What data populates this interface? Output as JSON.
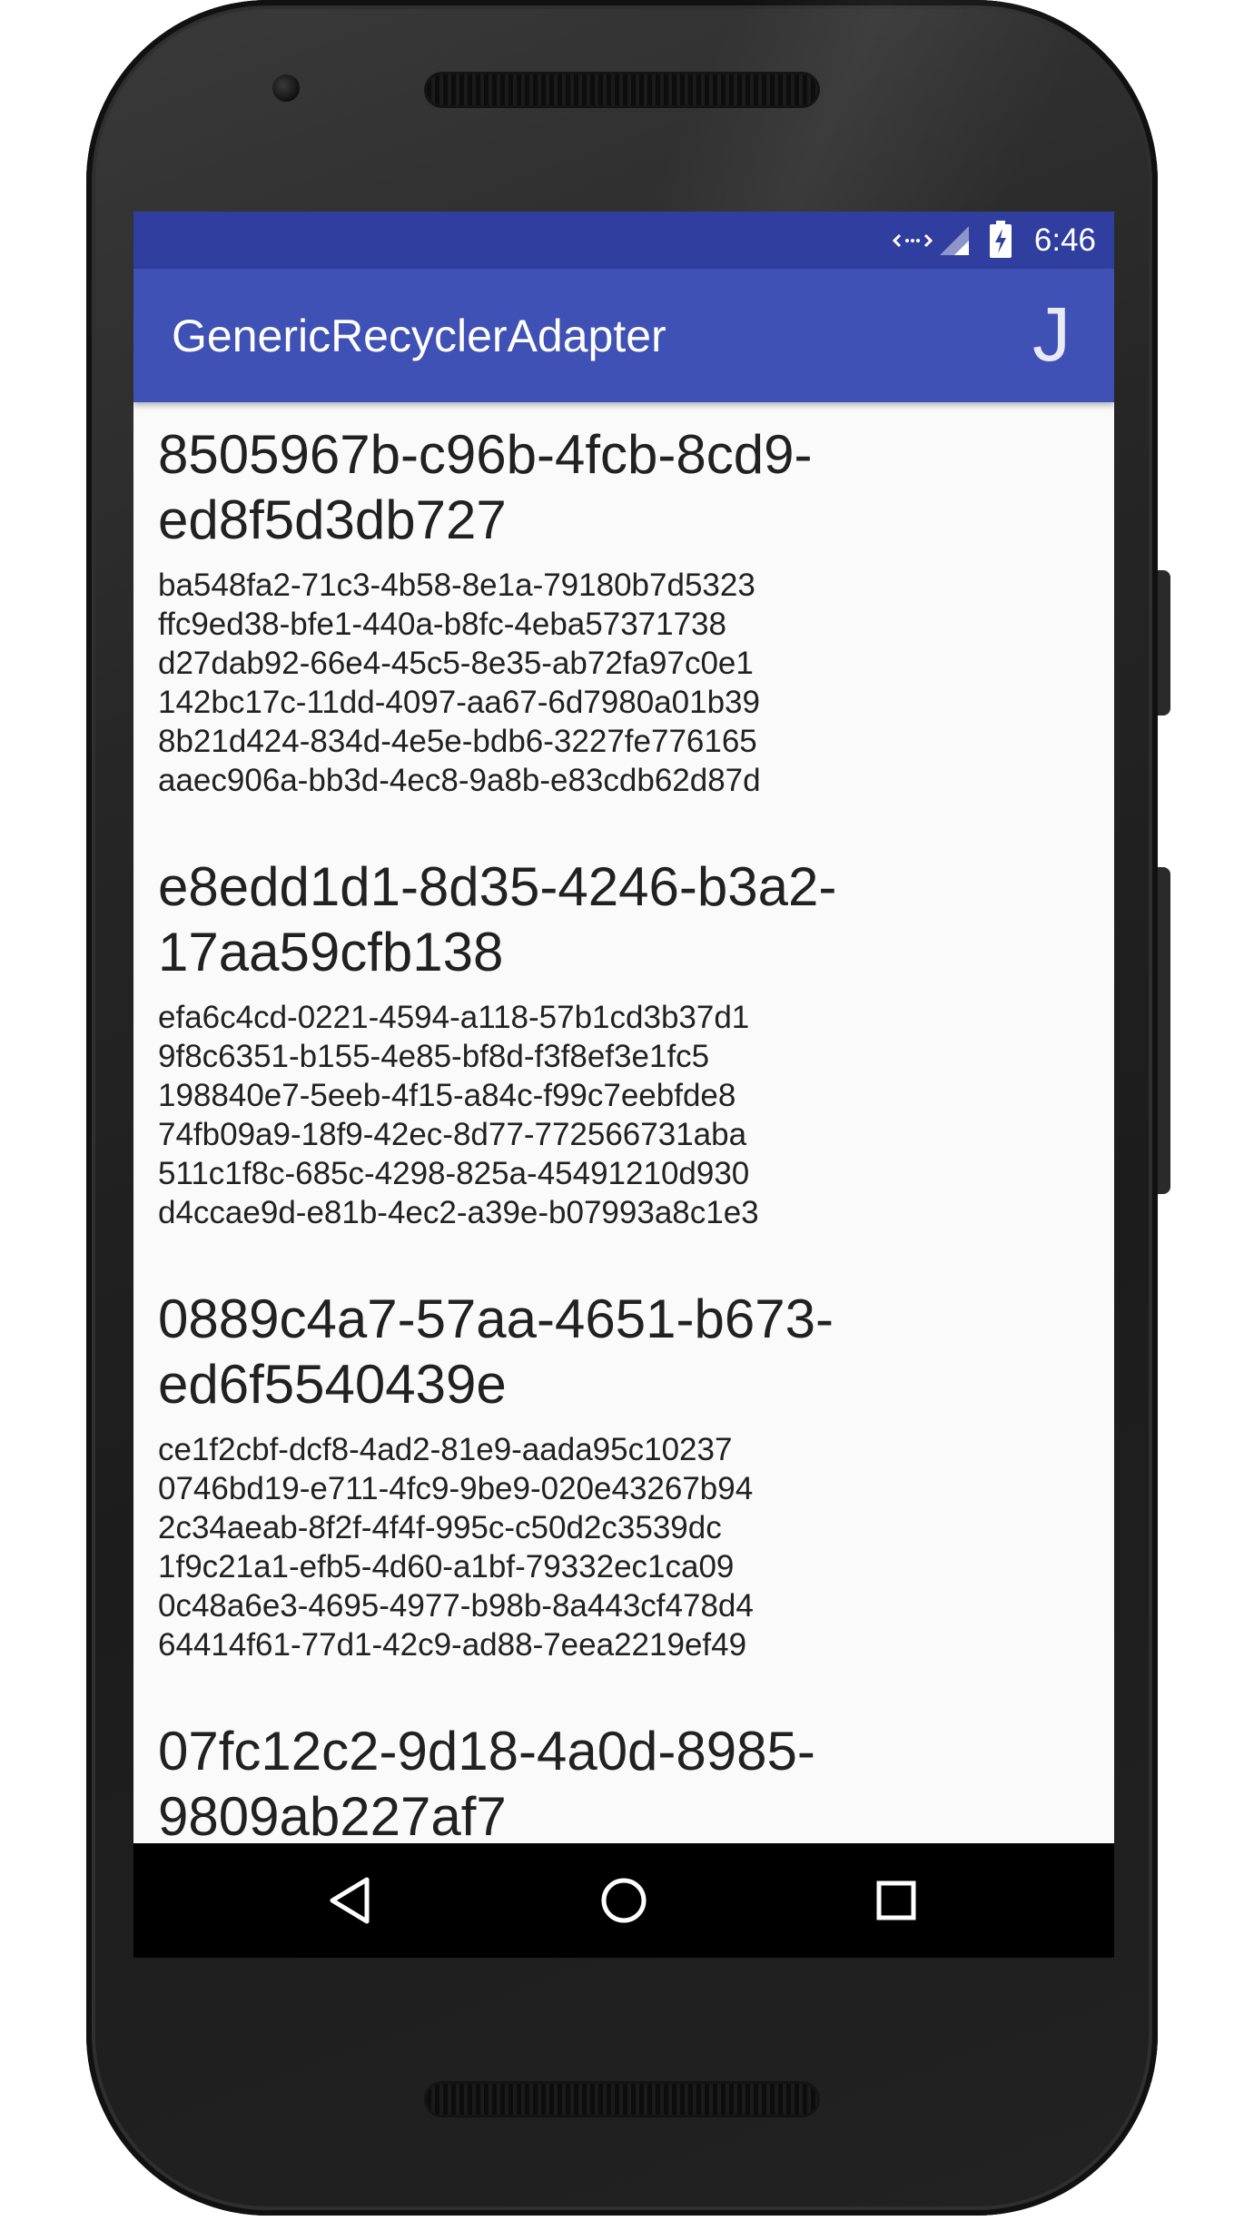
{
  "status_bar": {
    "time": "6:46",
    "icons": [
      "data-arrows-icon",
      "signal-icon",
      "battery-charging-icon"
    ]
  },
  "app_bar": {
    "title": "GenericRecyclerAdapter",
    "action_label": "J"
  },
  "list": {
    "items": [
      {
        "title": "8505967b-c96b-4fcb-8cd9-ed8f5d3db727",
        "title_lines": [
          "8505967b-c96b-4fcb-8cd9-",
          "ed8f5d3db727"
        ],
        "lines": [
          "ba548fa2-71c3-4b58-8e1a-79180b7d5323",
          "ffc9ed38-bfe1-440a-b8fc-4eba57371738",
          "d27dab92-66e4-45c5-8e35-ab72fa97c0e1",
          "142bc17c-11dd-4097-aa67-6d7980a01b39",
          "8b21d424-834d-4e5e-bdb6-3227fe776165",
          "aaec906a-bb3d-4ec8-9a8b-e83cdb62d87d"
        ]
      },
      {
        "title": "e8edd1d1-8d35-4246-b3a2-17aa59cfb138",
        "title_lines": [
          "e8edd1d1-8d35-4246-b3a2-",
          "17aa59cfb138"
        ],
        "lines": [
          "efa6c4cd-0221-4594-a118-57b1cd3b37d1",
          "9f8c6351-b155-4e85-bf8d-f3f8ef3e1fc5",
          "198840e7-5eeb-4f15-a84c-f99c7eebfde8",
          "74fb09a9-18f9-42ec-8d77-772566731aba",
          "511c1f8c-685c-4298-825a-45491210d930",
          "d4ccae9d-e81b-4ec2-a39e-b07993a8c1e3"
        ]
      },
      {
        "title": "0889c4a7-57aa-4651-b673-ed6f5540439e",
        "title_lines": [
          "0889c4a7-57aa-4651-b673-",
          "ed6f5540439e"
        ],
        "lines": [
          "ce1f2cbf-dcf8-4ad2-81e9-aada95c10237",
          "0746bd19-e711-4fc9-9be9-020e43267b94",
          "2c34aeab-8f2f-4f4f-995c-c50d2c3539dc",
          "1f9c21a1-efb5-4d60-a1bf-79332ec1ca09",
          "0c48a6e3-4695-4977-b98b-8a443cf478d4",
          "64414f61-77d1-42c9-ad88-7eea2219ef49"
        ]
      },
      {
        "title": "07fc12c2-9d18-4a0d-8985-9809ab227af7",
        "title_lines": [
          "07fc12c2-9d18-4a0d-8985-",
          "9809ab227af7"
        ],
        "lines": []
      }
    ]
  },
  "nav_bar": {
    "buttons": [
      "back-icon",
      "home-icon",
      "recents-icon"
    ]
  },
  "colors": {
    "status_bar": "#303f9f",
    "app_bar": "#3f51b5",
    "list_background": "#fafafa",
    "text_primary": "#212121"
  }
}
